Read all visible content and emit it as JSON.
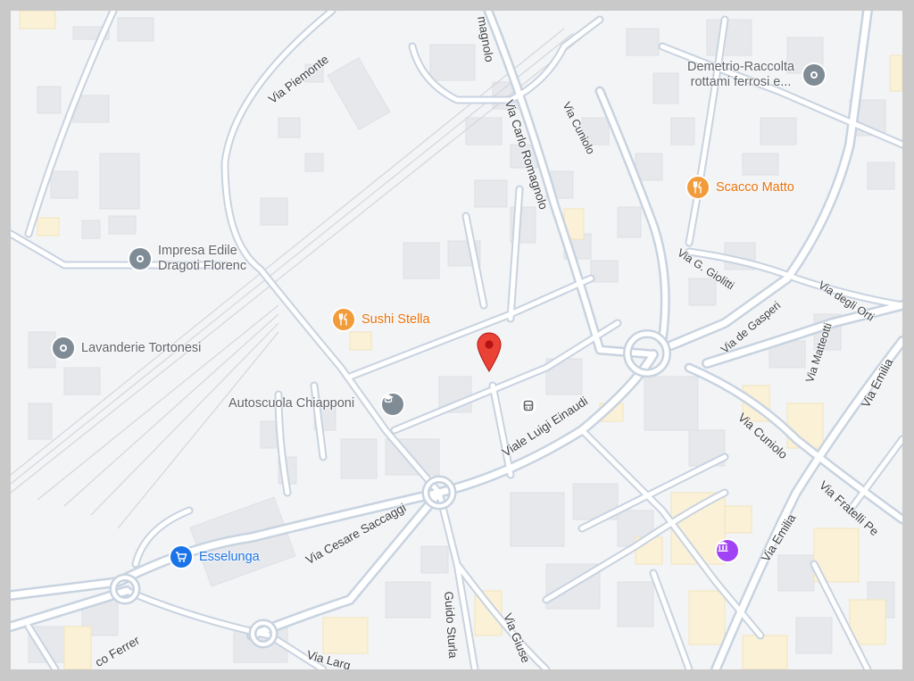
{
  "map": {
    "colors": {
      "background": "#f3f4f6",
      "road": "#c8d3e0",
      "building": "#e6e8ec",
      "highlight_building": "#fbf1d6",
      "frame": "#c9c9c9",
      "marker": "#ea4335",
      "food_poi": "#e8710a",
      "shop_poi": "#1a73e8",
      "generic_poi": "#7f8b95",
      "museum_poi": "#a142f4"
    },
    "pois": [
      {
        "name": "Demetrio-Raccolta rottami ferrosi e...",
        "line1": "Demetrio-Raccolta",
        "line2": "rottami ferrosi e...",
        "icon": "location-dot-icon",
        "category": "generic"
      },
      {
        "name": "Scacco Matto",
        "icon": "restaurant-icon",
        "category": "food"
      },
      {
        "name": "Impresa Edile Dragoti Florenc",
        "line1": "Impresa Edile",
        "line2": "Dragoti Florenc",
        "icon": "location-dot-icon",
        "category": "generic"
      },
      {
        "name": "Sushi Stella",
        "icon": "restaurant-icon",
        "category": "food"
      },
      {
        "name": "Lavanderie Tortonesi",
        "icon": "location-dot-icon",
        "category": "generic"
      },
      {
        "name": "Autoscuola Chiapponi",
        "icon": "school-icon",
        "category": "generic"
      },
      {
        "name": "Esselunga",
        "icon": "shopping-cart-icon",
        "category": "shop"
      }
    ],
    "streets": {
      "via_piemonte": "Via Piemonte",
      "romagnolo_top": "magnolo",
      "via_carlo_romagnolo": "Via Carlo Romagnolo",
      "via_cuniolo_top": "Via Cuniolo",
      "via_g_giolitti": "Via G. Giolitti",
      "via_degli_orti": "Via degli Orti",
      "via_de_gasperi": "Via de Gasperi",
      "via_matteotti": "Via Matteotti",
      "via_emilia_right": "Via Emilia",
      "viale_luigi_einaudi": "Viale Luigi Einaudi",
      "via_cuniolo_bottom": "Via Cuniolo",
      "via_fratelli_pe": "Via Fratelli Pe",
      "via_emilia_bottom": "Via Emilia",
      "via_cesare_saccaggi": "Via Cesare Saccaggi",
      "via_guido_sturla": "Guido Sturla",
      "via_giuse": "Via Giuse",
      "via_ferrer": "co Ferrer",
      "via_largo": "Via Larg"
    }
  }
}
